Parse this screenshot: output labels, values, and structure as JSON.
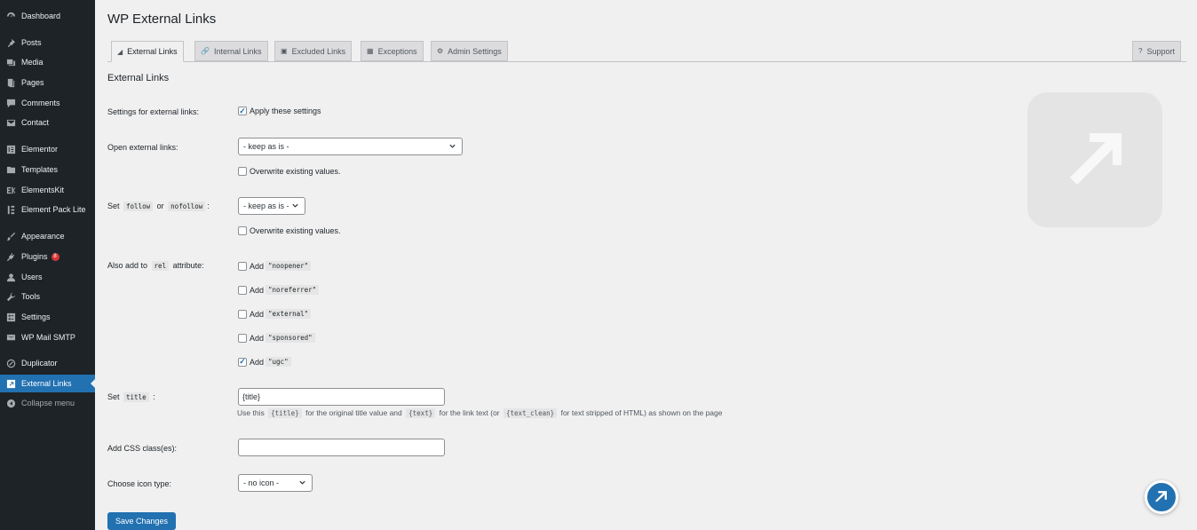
{
  "sidebar": {
    "items": [
      {
        "label": "Dashboard",
        "icon": "dashboard-icon"
      },
      {
        "label": "Posts",
        "icon": "pin-icon"
      },
      {
        "label": "Media",
        "icon": "media-icon"
      },
      {
        "label": "Pages",
        "icon": "page-icon"
      },
      {
        "label": "Comments",
        "icon": "comment-icon"
      },
      {
        "label": "Contact",
        "icon": "mail-icon"
      },
      {
        "label": "Elementor",
        "icon": "elementor-icon"
      },
      {
        "label": "Templates",
        "icon": "folder-icon"
      },
      {
        "label": "ElementsKit",
        "icon": "elementskit-icon"
      },
      {
        "label": "Element Pack Lite",
        "icon": "element-pack-icon"
      },
      {
        "label": "Appearance",
        "icon": "brush-icon"
      },
      {
        "label": "Plugins",
        "icon": "plug-icon",
        "badge": "8"
      },
      {
        "label": "Users",
        "icon": "user-icon"
      },
      {
        "label": "Tools",
        "icon": "wrench-icon"
      },
      {
        "label": "Settings",
        "icon": "settings-icon"
      },
      {
        "label": "WP Mail SMTP",
        "icon": "smtp-icon"
      },
      {
        "label": "Duplicator",
        "icon": "duplicator-icon"
      },
      {
        "label": "External Links",
        "icon": "external-link-icon",
        "active": true
      },
      {
        "label": "Collapse menu",
        "icon": "collapse-icon"
      }
    ]
  },
  "header": {
    "title": "WP External Links"
  },
  "tabs": [
    {
      "label": "External Links",
      "icon": "external-link-icon",
      "active": true
    },
    {
      "label": "Internal Links",
      "icon": "link-icon"
    },
    {
      "label": "Excluded Links",
      "icon": "excluded-icon"
    },
    {
      "label": "Exceptions",
      "icon": "grid-icon"
    },
    {
      "label": "Admin Settings",
      "icon": "gears-icon"
    }
  ],
  "support_tab": {
    "label": "Support",
    "icon": "question-icon"
  },
  "section_title": "External Links",
  "form": {
    "settings_label": "Settings for external links:",
    "apply_label": "Apply these settings",
    "apply_checked": true,
    "open_label": "Open external links:",
    "open_value": "- keep as is -",
    "overwrite_label": "Overwrite existing values.",
    "set_label_prefix": "Set",
    "follow_code": "follow",
    "or_text": "or",
    "nofollow_code": "nofollow",
    "set_label_suffix": ":",
    "follow_value": "- keep as is -",
    "overwrite2_label": "Overwrite existing values.",
    "rel_label_prefix": "Also add to",
    "rel_code": "rel",
    "rel_label_suffix": "attribute:",
    "rel_add": "Add",
    "rel_options": [
      {
        "code": "\"noopener\"",
        "checked": false
      },
      {
        "code": "\"noreferrer\"",
        "checked": false
      },
      {
        "code": "\"external\"",
        "checked": false
      },
      {
        "code": "\"sponsored\"",
        "checked": false
      },
      {
        "code": "\"ugc\"",
        "checked": true
      }
    ],
    "title_label_prefix": "Set",
    "title_code": "title",
    "title_label_suffix": ":",
    "title_value": "{title}",
    "help_use_this": "Use this",
    "help_code1": "{title}",
    "help_text1": "for the original title value and",
    "help_code2": "{text}",
    "help_text2": "for the link text (or",
    "help_code3": "{text_clean}",
    "help_text3": "for text stripped of HTML) as shown on the page",
    "css_label": "Add CSS class(es):",
    "css_value": "",
    "icon_label": "Choose icon type:",
    "icon_value": "- no icon -",
    "save_label": "Save Changes"
  },
  "colors": {
    "accent": "#2271b1",
    "sidebar": "#1d2327",
    "badge": "#d63638"
  }
}
